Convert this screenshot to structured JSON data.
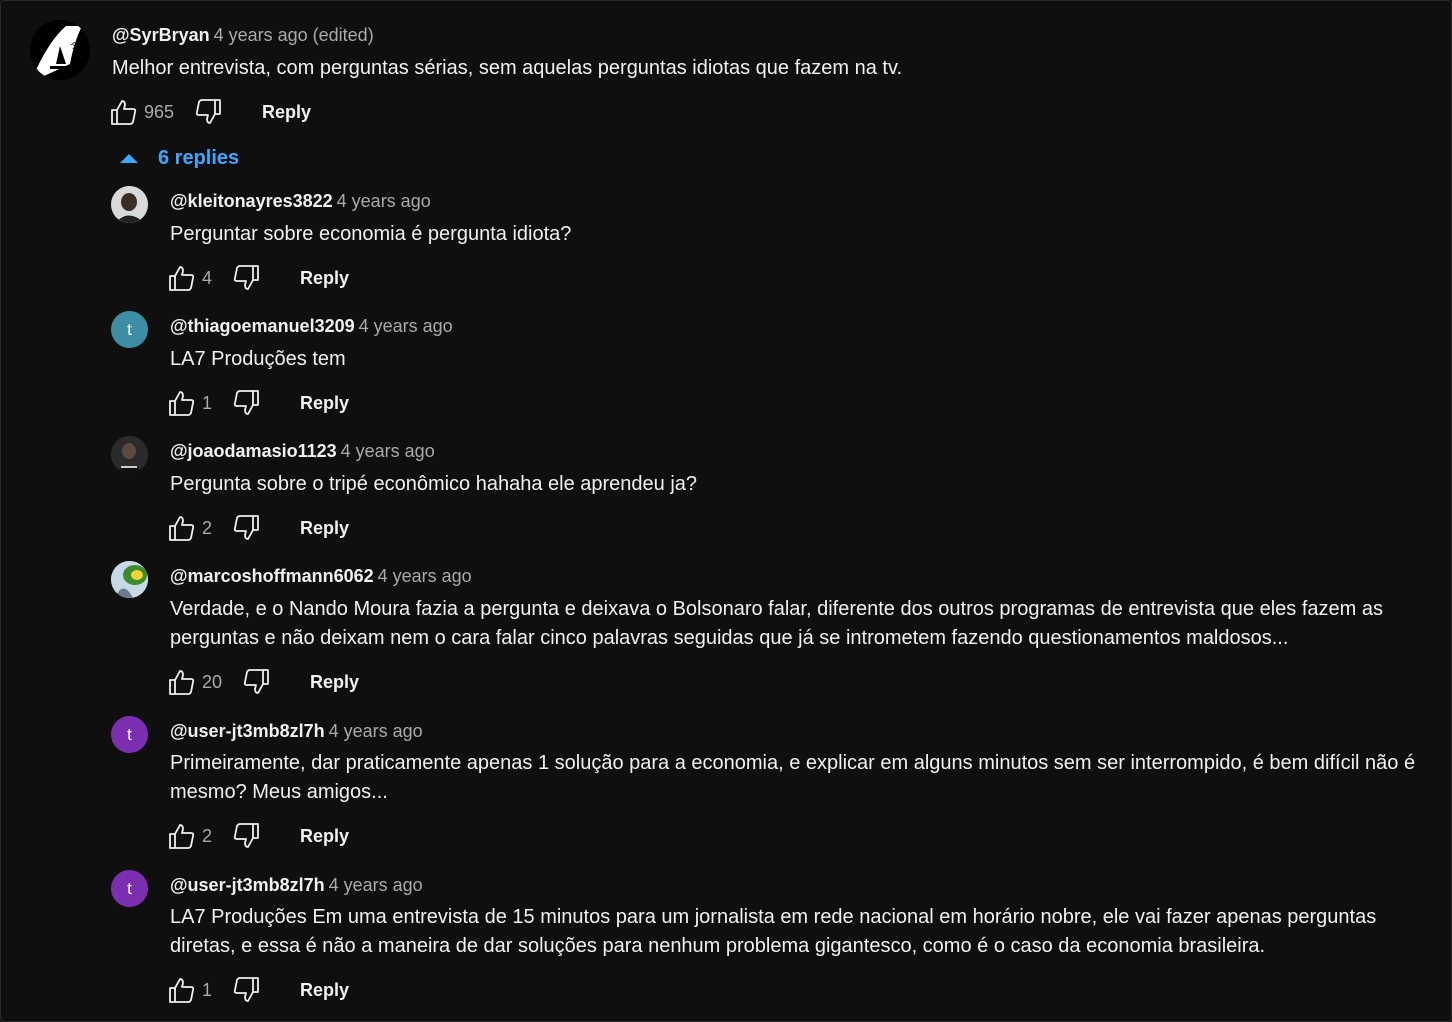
{
  "comment": {
    "author": "@SyrBryan",
    "time": "4 years ago (edited)",
    "text": "Melhor entrevista, com perguntas sérias, sem aquelas perguntas idiotas que fazem na tv.",
    "likes": "965",
    "reply_label": "Reply",
    "avatar_icon": "logo-avatar"
  },
  "replies_toggle": {
    "label": "6 replies",
    "icon": "caret-up-icon"
  },
  "replies": [
    {
      "author": "@kleitonayres3822",
      "time": "4 years ago",
      "text": "Perguntar sobre economia é pergunta idiota?",
      "likes": "4",
      "reply_label": "Reply",
      "avatar_letter": "",
      "avatar_color": "#6b6b6b"
    },
    {
      "author": "@thiagoemanuel3209",
      "time": "4 years ago",
      "text": "LA7 Produções tem",
      "likes": "1",
      "reply_label": "Reply",
      "avatar_letter": "t",
      "avatar_color": "#3d8ea4"
    },
    {
      "author": "@joaodamasio1123",
      "time": "4 years ago",
      "text": "Pergunta sobre o tripé econômico hahaha ele aprendeu ja?",
      "likes": "2",
      "reply_label": "Reply",
      "avatar_letter": "",
      "avatar_color": "#3a3a3a"
    },
    {
      "author": "@marcoshoffmann6062",
      "time": "4 years ago",
      "text": "Verdade, e o Nando Moura fazia a pergunta e deixava o Bolsonaro falar, diferente dos outros programas de entrevista que eles fazem as perguntas e não deixam nem o cara falar cinco palavras seguidas que já se intrometem fazendo questionamentos maldosos...",
      "likes": "20",
      "reply_label": "Reply",
      "avatar_letter": "",
      "avatar_color": "#b8c9d6"
    },
    {
      "author": "@user-jt3mb8zl7h",
      "time": "4 years ago",
      "text": "Primeiramente, dar praticamente apenas 1 solução para a economia, e explicar em alguns minutos sem ser interrompido, é bem difícil não é mesmo? Meus amigos...",
      "likes": "2",
      "reply_label": "Reply",
      "avatar_letter": "t",
      "avatar_color": "#7b2fb0"
    },
    {
      "author": "@user-jt3mb8zl7h",
      "time": "4 years ago",
      "text": "LA7 Produções Em uma entrevista de 15 minutos para um jornalista em rede nacional em horário nobre, ele vai fazer apenas perguntas diretas, e essa é não a maneira de dar soluções para nenhum problema gigantesco, como é o caso da economia brasileira.",
      "likes": "1",
      "reply_label": "Reply",
      "avatar_letter": "t",
      "avatar_color": "#7b2fb0"
    }
  ]
}
